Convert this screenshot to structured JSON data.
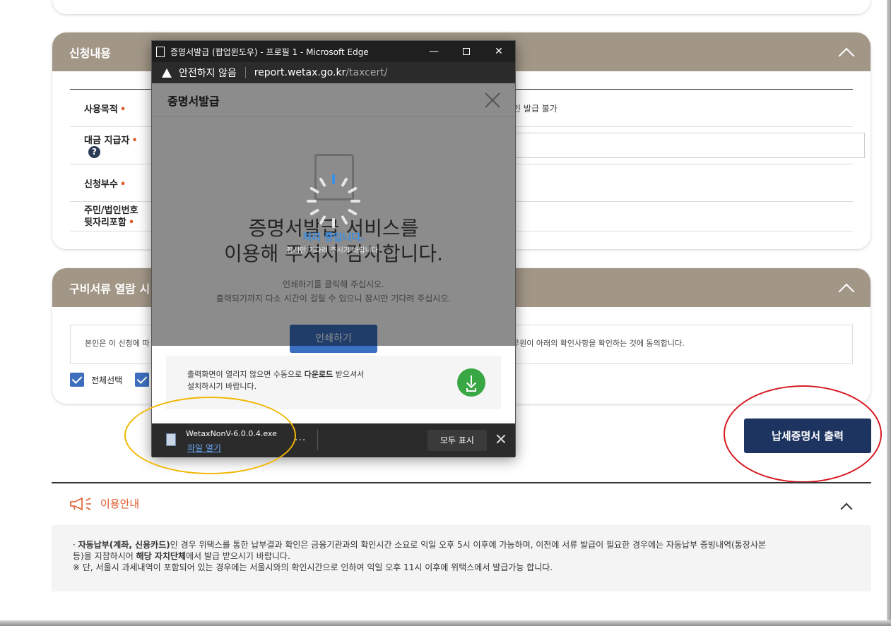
{
  "section_apply": {
    "title": "신청내용",
    "rows": [
      {
        "label": "사용목적",
        "value": "인 발급 불가"
      },
      {
        "label": "대금 지급자",
        "value": ""
      },
      {
        "label": "신청부수",
        "value": ""
      },
      {
        "label": "주민/법인번호\n뒷자리포함",
        "value": ""
      }
    ]
  },
  "section_docs": {
    "title": "구비서류 열람 시",
    "consent_left": "본인은 이 신청에 따",
    "consent_right": "무원이 아래의 확인사항을 확인하는 것에 동의합니다.",
    "select_all": "전체선택"
  },
  "issue_button": "납세증명서 출력",
  "guide": {
    "title": "이용안내",
    "line1_bold": "자동납부(계좌, 신용카드)",
    "line1_rest": "인 경우 위택스를 통한 납부결과 확인은 금융기관과의 확인시간 소요로 익일 오후 5시 이후에 가능하며, 이전에 서류 발급이 필요한 경우에는 자동납부 증빙내역(통장사본",
    "line2_pre": "등)을 지참하시어 ",
    "line2_bold": "해당 자치단체",
    "line2_post": "에서 발급 받으시기 바랍니다.",
    "line3": "※ 단, 서울시 과세내역이 포함되어 있는 경우에는 서울시와의 확인시간으로 인하여 익일 오후 11시 이후에 위택스에서 발급가능 합니다."
  },
  "popup": {
    "window_title": "증명서발급 (팝업윈도우) - 프로필 1 - Microsoft Edge",
    "security_label": "안전하지 않음",
    "url_host": "report.wetax.go.kr",
    "url_path": "/taxcert/",
    "header": "증명서발급",
    "service_line1": "증명서발급 서비스를",
    "service_line2": "이용해 주셔서 감사합니다.",
    "print_hint1": "인쇄하기를 클릭해 주십시오.",
    "print_hint2": "출력되기까지 다소 시간이 걸릴 수 있으니 잠시만 기다려 주십시오.",
    "print_button": "인쇄하기",
    "loading_main": "처리 중입니다.",
    "loading_sub": "잠시만 기다려 주시기 바랍니다.",
    "dl_hint_pre": "출력화면이 열리지 않으면 수동으로 ",
    "dl_hint_bold": "다운로드",
    "dl_hint_post": " 받으셔서",
    "dl_hint_line2": "설치하시기 바랍니다."
  },
  "download_bar": {
    "file_name": "WetaxNonV-6.0.0.4.exe",
    "open_file": "파일 열기",
    "more": "...",
    "show_all": "모두 표시"
  },
  "colors": {
    "section_header": "#a29787",
    "issue_button": "#1e3460",
    "accent_orange": "#e05a2a",
    "highlight_red": "#d71920",
    "highlight_yellow": "#f2b705"
  }
}
